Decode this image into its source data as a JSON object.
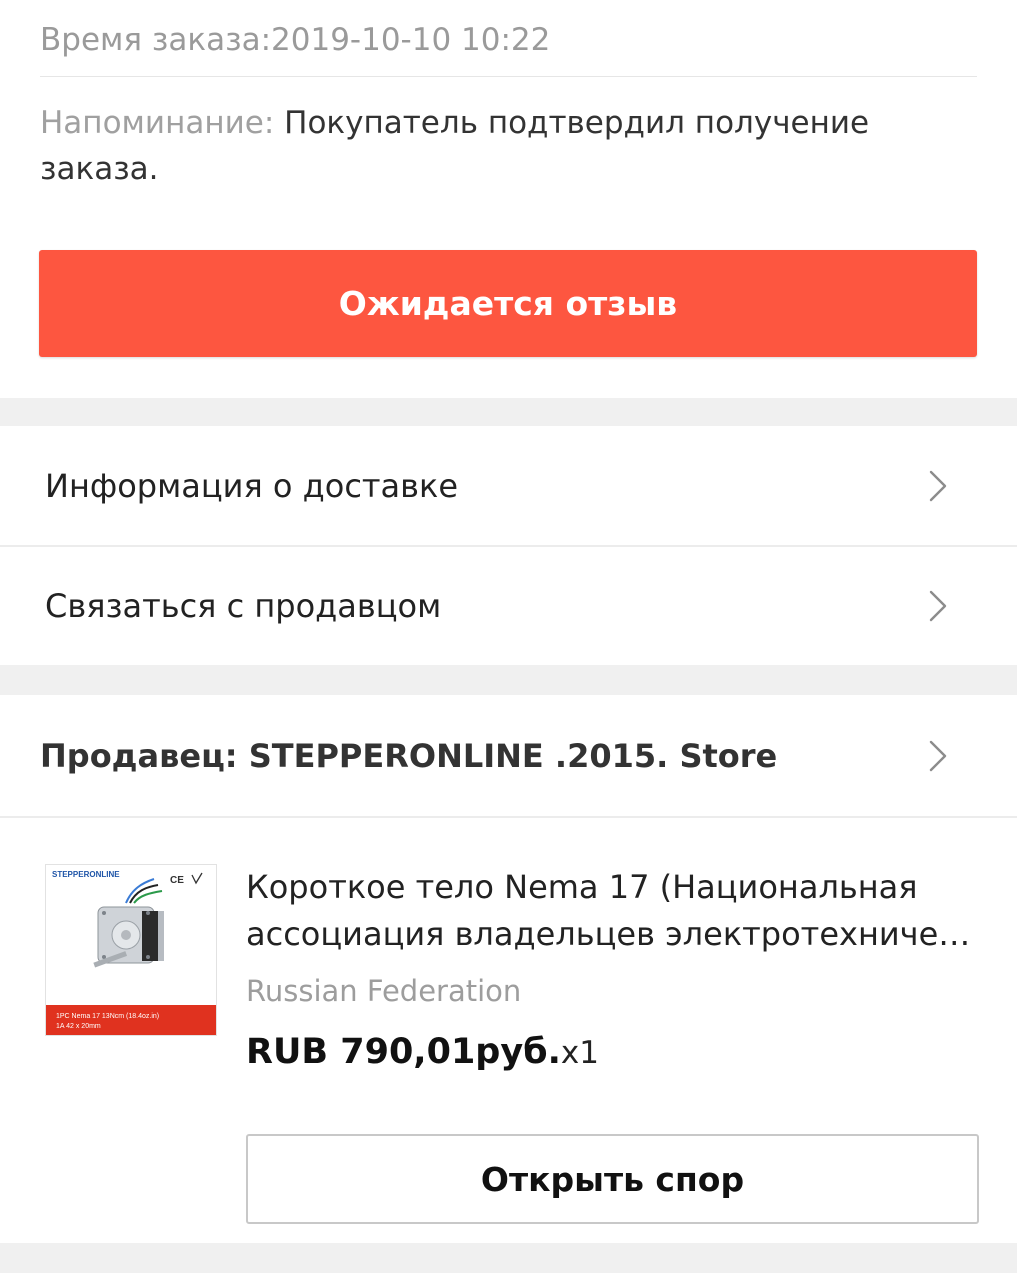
{
  "order": {
    "time_text": "Время заказа:2019-10-10 10:22",
    "reminder_label": "Напоминание:",
    "reminder_text": " Покупатель подтвердил получение заказа.",
    "status_button": "Ожидается отзыв"
  },
  "menu": {
    "delivery_info": "Информация о доставке",
    "contact_seller": "Связаться с продавцом"
  },
  "seller": {
    "label": "Продавец: STEPPERONLINE .2015. Store"
  },
  "product": {
    "title_line1": "Короткое тело Nema 17 (Национальная",
    "title_line2": "ассоциация владельцев электротехничес...",
    "country": "Russian Federation",
    "price": "RUB 790,01руб.",
    "quantity": "x1",
    "dispute_button": "Открыть спор",
    "thumb": {
      "brand": "STEPPERONLINE",
      "marks": "CE",
      "caption_line1": "1PC  Nema 17  13Ncm (18.4oz.in)",
      "caption_line2": "1A   42 x 20mm"
    }
  },
  "colors": {
    "accent": "#fd5640",
    "section_gap": "#f0f0f0",
    "muted_text": "#9a9a9a"
  },
  "icons": {
    "chevron": "chevron-right-icon"
  }
}
